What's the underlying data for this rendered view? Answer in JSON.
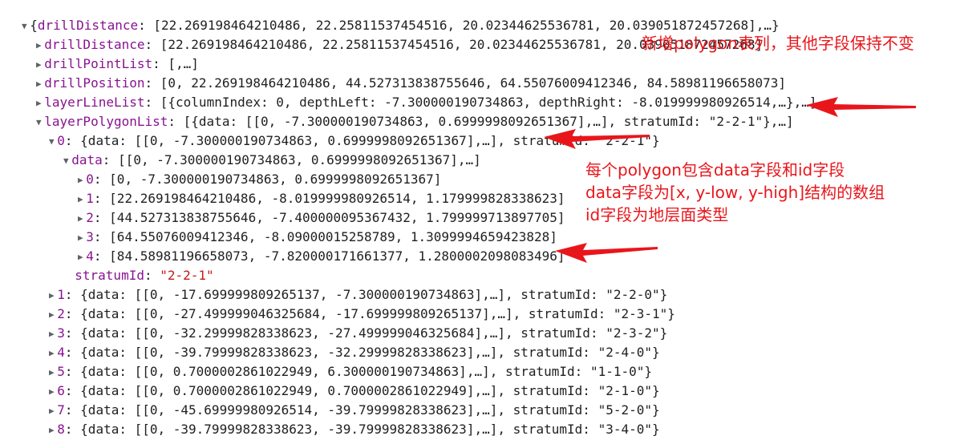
{
  "console": {
    "expanded_glyph": "▼",
    "collapsed_glyph": "▶",
    "root": {
      "prefix": "{",
      "key": "drillDistance",
      "value": "[22.269198464210486, 22.25811537454516, 20.02344625536781, 20.039051872457268]",
      "suffix": ",…}"
    },
    "props": [
      {
        "key": "drillDistance",
        "value": "[22.269198464210486, 22.25811537454516, 20.02344625536781, 20.039051872457268]"
      },
      {
        "key": "drillPointList",
        "value": "[,…]"
      },
      {
        "key": "drillPosition",
        "value": "[0, 22.269198464210486, 44.527313838755646, 64.55076009412346, 84.58981196658073]"
      },
      {
        "key": "layerLineList",
        "value": "[{columnIndex: 0, depthLeft: -7.300000190734863, depthRight: -8.019999980926514,…},…]"
      },
      {
        "key": "layerPolygonList",
        "value": "[{data: [[0, -7.300000190734863, 0.6999998092651367],…], stratumId: \"2-2-1\"},…]"
      }
    ],
    "polygon0": {
      "key": "0",
      "value": "{data: [[0, -7.300000190734863, 0.6999998092651367],…], stratumId: \"2-2-1\"}"
    },
    "data_node": {
      "key": "data",
      "value": "[[0, -7.300000190734863, 0.6999998092651367],…]"
    },
    "data_items": [
      {
        "key": "0",
        "value": "[0, -7.300000190734863, 0.6999998092651367]"
      },
      {
        "key": "1",
        "value": "[22.269198464210486, -8.019999980926514, 1.179999828338623]"
      },
      {
        "key": "2",
        "value": "[44.527313838755646, -7.400000095367432, 1.799999713897705]"
      },
      {
        "key": "3",
        "value": "[64.55076009412346, -8.09000015258789, 1.3099994659423828]"
      },
      {
        "key": "4",
        "value": "[84.58981196658073, -7.820000171661377, 1.2800002098083496]"
      }
    ],
    "stratum": {
      "key": "stratumId",
      "value": "\"2-2-1\""
    },
    "polygons": [
      {
        "key": "1",
        "value": "{data: [[0, -17.699999809265137, -7.300000190734863],…], stratumId: \"2-2-0\"}"
      },
      {
        "key": "2",
        "value": "{data: [[0, -27.499999046325684, -17.699999809265137],…], stratumId: \"2-3-1\"}"
      },
      {
        "key": "3",
        "value": "{data: [[0, -32.29999828338623, -27.499999046325684],…], stratumId: \"2-3-2\"}"
      },
      {
        "key": "4",
        "value": "{data: [[0, -39.79999828338623, -32.29999828338623],…], stratumId: \"2-4-0\"}"
      },
      {
        "key": "5",
        "value": "{data: [[0, 0.7000002861022949, 6.300000190734863],…], stratumId: \"1-1-0\"}"
      },
      {
        "key": "6",
        "value": "{data: [[0, 0.7000002861022949, 0.7000002861022949],…], stratumId: \"2-1-0\"}"
      },
      {
        "key": "7",
        "value": "{data: [[0, -45.69999980926514, -39.79999828338623],…], stratumId: \"5-2-0\"}"
      },
      {
        "key": "8",
        "value": "{data: [[0, -39.79999828338623, -39.79999828338623],…], stratumId: \"3-4-0\"}"
      }
    ]
  },
  "annotations": {
    "note1": "新增polygon表列，其他字段保持不变",
    "note2_line1": "每个polygon包含data字段和id字段",
    "note2_line2": "data字段为[x, y-low, y-high]结构的数组",
    "note2_line3": "id字段为地层面类型"
  },
  "colors": {
    "key": "#881391",
    "number": "#1a1aa6",
    "string": "#c41a16",
    "annotation": "#e8161b"
  }
}
